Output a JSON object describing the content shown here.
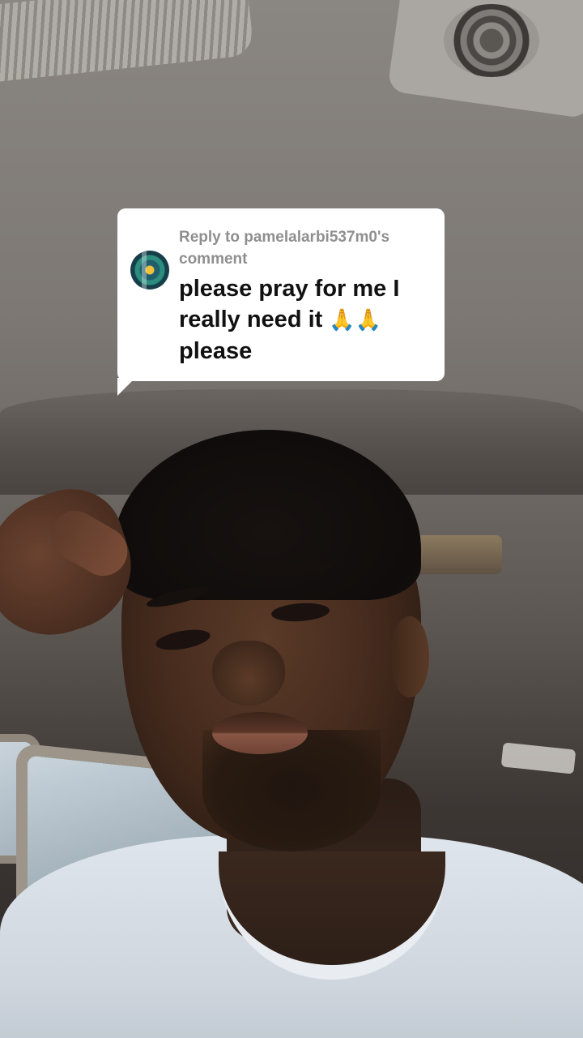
{
  "reply": {
    "meta_text": "Reply to pamelalarbi537m0's comment",
    "comment_line1": "please pray for me I",
    "comment_line2": "really need it",
    "comment_emoji": "🙏🙏",
    "comment_line3": "please"
  },
  "icons": {
    "avatar": "commenter-avatar"
  },
  "colors": {
    "bubble_bg": "#ffffff",
    "meta_text": "#8f8f8f",
    "comment_text": "#111111"
  }
}
